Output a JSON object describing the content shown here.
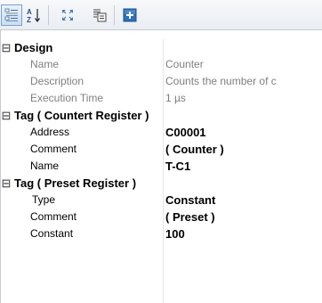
{
  "toolbar": {
    "buttons": [
      {
        "name": "categorized-icon",
        "active": true
      },
      {
        "name": "sort-alphabetical-icon",
        "active": false
      },
      {
        "name": "expand-collapse-icon",
        "active": false
      },
      {
        "name": "property-pages-icon",
        "active": false
      },
      {
        "name": "add-icon",
        "active": false
      }
    ],
    "sort_glyph_top": "A",
    "sort_glyph_bottom": "Z"
  },
  "categories": [
    {
      "label": "Design",
      "expander": "⊟",
      "properties": [
        {
          "label": "Name",
          "value": "Counter"
        },
        {
          "label": "Description",
          "value": "Counts the number of c"
        },
        {
          "label": "Execution Time",
          "value": "1 µs"
        }
      ]
    },
    {
      "label": "Tag ( Countert Register )",
      "expander": "⊟",
      "properties": [
        {
          "label": "Address",
          "value": "C00001"
        },
        {
          "label": "Comment",
          "value": "( Counter )"
        },
        {
          "label": "Name",
          "value": "T-C1"
        }
      ]
    },
    {
      "label": "Tag ( Preset Register )",
      "expander": "⊟",
      "properties": [
        {
          "label": "Type",
          "value": "Constant"
        },
        {
          "label": "Comment",
          "value": "( Preset )"
        },
        {
          "label": "Constant",
          "value": "100"
        }
      ]
    }
  ],
  "colors": {
    "readonly_text": "#7f7f7f",
    "add_icon_blue": "#2f6fb5"
  }
}
